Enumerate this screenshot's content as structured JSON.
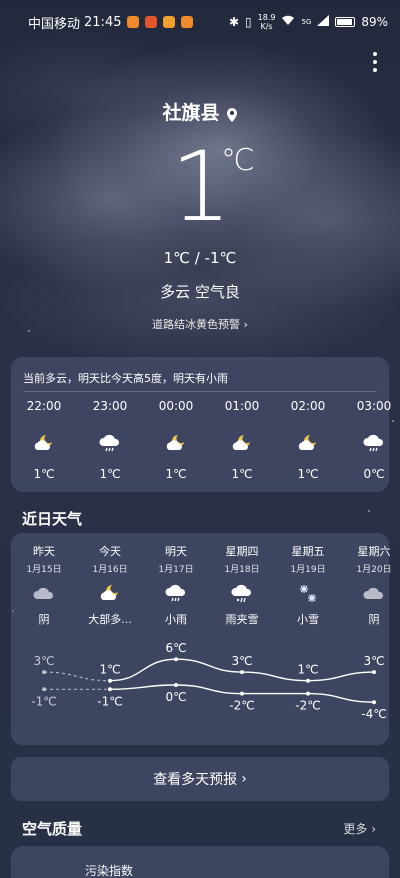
{
  "status_bar": {
    "carrier": "中国移动",
    "time": "21:45",
    "net_speed_value": "18.9",
    "net_speed_unit": "K/s",
    "signal_label": "5G",
    "battery": "89%"
  },
  "location": {
    "city": "社旗县"
  },
  "current": {
    "temp": "1",
    "unit": "℃",
    "range": "1℃ / -1℃",
    "condition": "多云  空气良",
    "warning": "道路结冰黄色预警"
  },
  "hourly": {
    "summary": "当前多云，明天比今天高5度，明天有小雨",
    "items": [
      {
        "time": "22:00",
        "icon": "moon-cloud-icon",
        "temp": "1℃"
      },
      {
        "time": "23:00",
        "icon": "cloud-rain-icon",
        "temp": "1℃"
      },
      {
        "time": "00:00",
        "icon": "moon-cloud-icon",
        "temp": "1℃"
      },
      {
        "time": "01:00",
        "icon": "moon-cloud-icon",
        "temp": "1℃"
      },
      {
        "time": "02:00",
        "icon": "moon-cloud-icon",
        "temp": "1℃"
      },
      {
        "time": "03:00",
        "icon": "cloud-rain-icon",
        "temp": "0℃"
      }
    ]
  },
  "daily": {
    "title": "近日天气",
    "days": [
      {
        "name": "昨天",
        "date": "1月15日",
        "icon": "cloud-icon",
        "cond": "阴",
        "high": "3℃",
        "low": "-1℃"
      },
      {
        "name": "今天",
        "date": "1月16日",
        "icon": "moon-cloud-icon",
        "cond": "大部多...",
        "high": "1℃",
        "low": "-1℃"
      },
      {
        "name": "明天",
        "date": "1月17日",
        "icon": "cloud-rain-icon",
        "cond": "小雨",
        "high": "6℃",
        "low": "0℃"
      },
      {
        "name": "星期四",
        "date": "1月18日",
        "icon": "cloud-sleet-icon",
        "cond": "雨夹雪",
        "high": "3℃",
        "low": "-2℃"
      },
      {
        "name": "星期五",
        "date": "1月19日",
        "icon": "snowflake-icon",
        "cond": "小雪",
        "high": "1℃",
        "low": "-2℃"
      },
      {
        "name": "星期六",
        "date": "1月20日",
        "icon": "cloud-icon",
        "cond": "阴",
        "high": "3℃",
        "low": "-4℃"
      }
    ],
    "highs": [
      3,
      1,
      6,
      3,
      1,
      3
    ],
    "lows": [
      -1,
      -1,
      0,
      -2,
      -2,
      -4
    ]
  },
  "forecast_button": "查看多天预报",
  "air_quality": {
    "title": "空气质量",
    "more": "更多",
    "index_label": "污染指数"
  }
}
